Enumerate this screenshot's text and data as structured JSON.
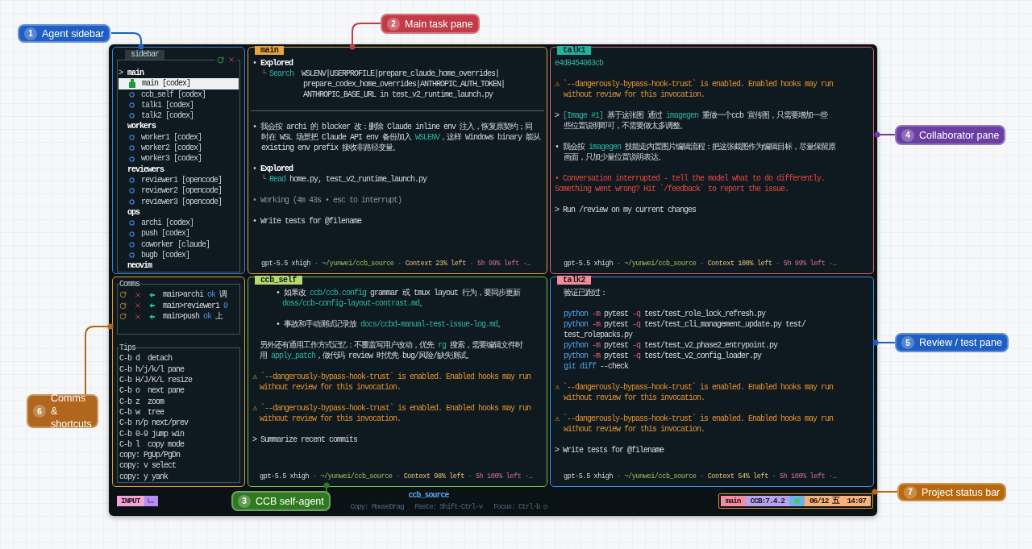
{
  "callouts": [
    {
      "number": "1",
      "label": "Agent sidebar",
      "color": "#1f5fc4"
    },
    {
      "number": "2",
      "label": "Main task pane",
      "color": "#c23b47"
    },
    {
      "number": "3",
      "label": "CCB self-agent",
      "color": "#2f7a20"
    },
    {
      "number": "4",
      "label": "Collaborator pane",
      "color": "#6a3ea3"
    },
    {
      "number": "5",
      "label": "Review / test pane",
      "color": "#1f5fc4"
    },
    {
      "number": "6",
      "label": "Comms & shortcuts",
      "color": "#b0661c"
    },
    {
      "number": "7",
      "label": "Project status bar",
      "color": "#b8690f"
    }
  ],
  "sidebar": {
    "title": "sidebar",
    "groups": [
      {
        "label": "main",
        "marker": ">",
        "agents": [
          {
            "label": "main [codex]",
            "selected": true
          },
          {
            "label": "ccb_self [codex]",
            "selected": false
          },
          {
            "label": "talk1 [codex]",
            "selected": false
          },
          {
            "label": "talk2 [codex]",
            "selected": false
          }
        ]
      },
      {
        "label": "workers",
        "agents": [
          {
            "label": "worker1 [codex]",
            "selected": false
          },
          {
            "label": "worker2 [codex]",
            "selected": false
          },
          {
            "label": "worker3 [codex]",
            "selected": false
          }
        ]
      },
      {
        "label": "reviewers",
        "agents": [
          {
            "label": "reviewer1 [opencode]",
            "selected": false
          },
          {
            "label": "reviewer2 [opencode]",
            "selected": false
          },
          {
            "label": "reviewer3 [opencode]",
            "selected": false
          }
        ]
      },
      {
        "label": "ops",
        "agents": [
          {
            "label": "archi [codex]",
            "selected": false
          },
          {
            "label": "push [codex]",
            "selected": false
          },
          {
            "label": "coworker [claude]",
            "selected": false
          },
          {
            "label": "bugb [codex]",
            "selected": false
          }
        ]
      },
      {
        "label": "neovim"
      }
    ]
  },
  "comms": {
    "title": "Comms",
    "rows": [
      {
        "route": "main>archi",
        "status": "ok",
        "note": "调"
      },
      {
        "route": "main>reviewer1",
        "status": "0"
      },
      {
        "route": "main>push",
        "status": "ok",
        "note": "上"
      }
    ]
  },
  "tips": {
    "title": "Tips",
    "lines": [
      "C-b d  detach",
      "C-b h/j/k/l pane",
      "C-b H/J/K/L resize",
      "C-b o  next pane",
      "C-b z  zoom",
      "C-b w  tree",
      "C-b n/p next/prev",
      "C-b 0-9 jump win",
      "C-b l  copy mode",
      "copy: PgUp/PgDn",
      "copy: v select",
      "copy: y yank"
    ]
  },
  "panes": [
    {
      "tab": {
        "title": "main",
        "color": "#e9a43c"
      },
      "color": "#e0a040",
      "blocks": [
        {
          "kind": "lines",
          "lines": [
            {
              "segs": [
                {
                  "kind": "plain",
                  "text": "• "
                },
                {
                  "kind": "bold",
                  "text": "Explored"
                }
              ]
            },
            {
              "kind": "hang",
              "segs": [
                {
                  "kind": "dim",
                  "text": "└ "
                },
                {
                  "kind": "accent",
                  "text": "Search"
                },
                {
                  "kind": "plain",
                  "text": "  WSLENV|USERPROFILE|prepare_claude_home_overrides|"
                }
              ]
            },
            {
              "kind": "search",
              "segs": [
                {
                  "kind": "plain",
                  "text": "prepare_codex_home_overrides|ANTHROPIC_AUTH_TOKEN|"
                }
              ]
            },
            {
              "kind": "search",
              "segs": [
                {
                  "kind": "plain",
                  "text": "ANTHROPIC_BASE_URL in test_v2_runtime_launch.py"
                }
              ]
            }
          ]
        },
        {
          "kind": "rule"
        },
        {
          "kind": "lines",
          "lines": [
            {
              "segs": [
                {
                  "kind": "plain",
                  "text": "• 我会按 archi 的 blocker 改：删除 Claude inline env 注入，恢复原契约；同"
                }
              ]
            },
            {
              "kind": "hang",
              "segs": [
                {
                  "kind": "plain",
                  "text": "时在 WSL 场景把 Claude API env 备份加入 "
                },
                {
                  "kind": "accent",
                  "text": "WSLENV"
                },
                {
                  "kind": "plain",
                  "text": "，这样 Windows binary 能从"
                }
              ]
            },
            {
              "kind": "hang",
              "segs": [
                {
                  "kind": "plain",
                  "text": "existing env prefix 接收非路径变量。"
                }
              ]
            }
          ]
        },
        {
          "kind": "lines",
          "lines": [
            {
              "segs": [
                {
                  "kind": "plain",
                  "text": "• "
                },
                {
                  "kind": "bold",
                  "text": "Explored"
                }
              ]
            },
            {
              "kind": "hang",
              "segs": [
                {
                  "kind": "dim",
                  "text": "└ "
                },
                {
                  "kind": "accent",
                  "text": "Read"
                },
                {
                  "kind": "plain",
                  "text": " home.py, test_v2_runtime_launch.py"
                }
              ]
            }
          ]
        },
        {
          "kind": "lines",
          "lines": [
            {
              "segs": [
                {
                  "kind": "dim",
                  "text": "• Working (4m 43s • esc to interrupt)"
                }
              ]
            }
          ]
        },
        {
          "kind": "lines",
          "lines": [
            {
              "segs": [
                {
                  "kind": "plain",
                  "text": "• Write tests for @filename"
                }
              ]
            }
          ]
        }
      ],
      "footer": {
        "kind": "hang",
        "segs": [
          {
            "kind": "plain",
            "text": "gpt-5.5 xhigh"
          },
          {
            "kind": "dim",
            "text": " · "
          },
          {
            "kind": "path",
            "text": "~/yunwei/ccb_source"
          },
          {
            "kind": "dim",
            "text": " · "
          },
          {
            "kind": "context",
            "text": "Context 23% left"
          },
          {
            "kind": "dim",
            "text": " · "
          },
          {
            "kind": "quota",
            "text": "5h 99% left"
          },
          {
            "kind": "dim",
            "text": " ·…"
          }
        ]
      }
    },
    {
      "tab": {
        "title": "talk1",
        "color": "#1fb3a2"
      },
      "color": "#d9607c",
      "blocks": [
        {
          "kind": "lines",
          "lines": [
            {
              "segs": [
                {
                  "kind": "hash",
                  "text": "e4d8454063cb"
                }
              ]
            }
          ]
        },
        {
          "kind": "lines",
          "lines": [
            {
              "segs": [
                {
                  "kind": "warn",
                  "text": "⚠ `--dangerously-bypass-hook-trust` is enabled. Enabled hooks may run"
                }
              ]
            },
            {
              "kind": "hang",
              "segs": [
                {
                  "kind": "warn",
                  "text": "without review for this invocation."
                }
              ]
            }
          ]
        },
        {
          "kind": "lines",
          "lines": [
            {
              "segs": [
                {
                  "kind": "plain",
                  "text": "> "
                },
                {
                  "kind": "accent",
                  "text": "[Image #1]"
                },
                {
                  "kind": "plain",
                  "text": " 基于这张图 通过 "
                },
                {
                  "kind": "accent",
                  "text": "imagegen"
                },
                {
                  "kind": "plain",
                  "text": " 重做一个ccb 宣传图，只需要增加一些"
                }
              ]
            },
            {
              "kind": "hang",
              "segs": [
                {
                  "kind": "plain",
                  "text": "些位置说明即可，不需要做太多调整。"
                }
              ]
            }
          ]
        },
        {
          "kind": "lines",
          "lines": [
            {
              "segs": [
                {
                  "kind": "plain",
                  "text": "• 我会按 "
                },
                {
                  "kind": "accent",
                  "text": "imagegen"
                },
                {
                  "kind": "plain",
                  "text": " 技能走内置图片编辑流程：把这张截图作为编辑目标，尽量保留原"
                }
              ]
            },
            {
              "kind": "hang",
              "segs": [
                {
                  "kind": "plain",
                  "text": "画面，只加少量位置说明表达。"
                }
              ]
            }
          ]
        },
        {
          "kind": "lines",
          "lines": [
            {
              "segs": [
                {
                  "kind": "error",
                  "text": "• Conversation interrupted - tell the model what to do differently."
                }
              ]
            },
            {
              "segs": [
                {
                  "kind": "error",
                  "text": "Something went wrong? Hit `/feedback` to report the issue."
                }
              ]
            }
          ]
        },
        {
          "kind": "lines",
          "lines": [
            {
              "segs": [
                {
                  "kind": "plain",
                  "text": "> Run /review on my current changes"
                }
              ]
            }
          ]
        }
      ],
      "footer": {
        "kind": "hang",
        "segs": [
          {
            "kind": "plain",
            "text": "gpt-5.5 xhigh"
          },
          {
            "kind": "dim",
            "text": " · "
          },
          {
            "kind": "path",
            "text": "~/yunwei/ccb_source"
          },
          {
            "kind": "dim",
            "text": " · "
          },
          {
            "kind": "context",
            "text": "Context 100% left"
          },
          {
            "kind": "dim",
            "text": " · "
          },
          {
            "kind": "quota",
            "text": "5h 99% left"
          },
          {
            "kind": "dim",
            "text": " ·…"
          }
        ]
      }
    },
    {
      "tab": {
        "title": "ccb_self",
        "color": "#b6d96c"
      },
      "color": "#78bd48",
      "blocks": [
        {
          "kind": "lines",
          "lines": [
            {
              "kind": "nested",
              "segs": [
                {
                  "kind": "plain",
                  "text": "• 如果改 "
                },
                {
                  "kind": "accent",
                  "text": "ccb/ccb.config"
                },
                {
                  "kind": "plain",
                  "text": " grammar 或 tmux layout 行为，要同步更新"
                }
              ]
            },
            {
              "kind": "nested_hang",
              "segs": [
                {
                  "kind": "accent",
                  "text": "doss/ccb-config-layout-contrast.md"
                },
                {
                  "kind": "plain",
                  "text": "。"
                }
              ]
            }
          ]
        },
        {
          "kind": "lines",
          "lines": [
            {
              "kind": "nested",
              "segs": [
                {
                  "kind": "plain",
                  "text": "• 事故和手动测试记录放 "
                },
                {
                  "kind": "accent",
                  "text": "docs/ccbd-manual-test-issue-log.md"
                },
                {
                  "kind": "plain",
                  "text": "。"
                }
              ]
            }
          ]
        },
        {
          "kind": "lines",
          "lines": [
            {
              "kind": "para",
              "segs": [
                {
                  "kind": "plain",
                  "text": "另外还有通用工作方式记忆：不覆盖写用户改动，优先 "
                },
                {
                  "kind": "accent",
                  "text": "rg"
                },
                {
                  "kind": "plain",
                  "text": " 搜索，需要编辑文件时"
                }
              ]
            },
            {
              "kind": "para",
              "segs": [
                {
                  "kind": "plain",
                  "text": "用 "
                },
                {
                  "kind": "accent",
                  "text": "apply_patch"
                },
                {
                  "kind": "plain",
                  "text": "，做代码 review 时优先 bug/风险/缺失测试。"
                }
              ]
            }
          ]
        },
        {
          "kind": "lines",
          "lines": [
            {
              "segs": [
                {
                  "kind": "warn",
                  "text": "⚠ `--dangerously-bypass-hook-trust` is enabled. Enabled hooks may run"
                }
              ]
            },
            {
              "kind": "para",
              "segs": [
                {
                  "kind": "warn",
                  "text": "without review for this invocation."
                }
              ]
            }
          ]
        },
        {
          "kind": "lines",
          "lines": [
            {
              "segs": [
                {
                  "kind": "warn",
                  "text": "⚠ `--dangerously-bypass-hook-trust` is enabled. Enabled hooks may run"
                }
              ]
            },
            {
              "kind": "para",
              "segs": [
                {
                  "kind": "warn",
                  "text": "without review for this invocation."
                }
              ]
            }
          ]
        },
        {
          "kind": "lines",
          "lines": [
            {
              "segs": [
                {
                  "kind": "plain",
                  "text": "> Summarize recent commits"
                }
              ]
            }
          ]
        }
      ],
      "footer": {
        "kind": "para",
        "segs": [
          {
            "kind": "plain",
            "text": "gpt-5.5 xhigh"
          },
          {
            "kind": "dim",
            "text": " · "
          },
          {
            "kind": "path",
            "text": "~/yunwei/ccb_source"
          },
          {
            "kind": "dim",
            "text": " · "
          },
          {
            "kind": "context",
            "text": "Context 98% left"
          },
          {
            "kind": "dim",
            "text": " · "
          },
          {
            "kind": "quota",
            "text": "5h 100% left"
          },
          {
            "kind": "dim",
            "text": " ·…"
          }
        ]
      }
    },
    {
      "tab": {
        "title": "talk2",
        "color": "#f28c9c"
      },
      "color": "#3b8ee0",
      "blocks": [
        {
          "kind": "lines",
          "lines": [
            {
              "kind": "hang",
              "segs": [
                {
                  "kind": "plain",
                  "text": "验证已跑过："
                }
              ]
            }
          ]
        },
        {
          "kind": "lines",
          "lines": [
            {
              "kind": "hang",
              "segs": [
                {
                  "kind": "keyword",
                  "text": "python"
                },
                {
                  "kind": "flag",
                  "text": " -m"
                },
                {
                  "kind": "plain",
                  "text": " pytest"
                },
                {
                  "kind": "flag",
                  "text": " -q"
                },
                {
                  "kind": "plain",
                  "text": " test/test_role_lock_refresh.py"
                }
              ]
            },
            {
              "kind": "hang",
              "segs": [
                {
                  "kind": "keyword",
                  "text": "python"
                },
                {
                  "kind": "flag",
                  "text": " -m"
                },
                {
                  "kind": "plain",
                  "text": " pytest"
                },
                {
                  "kind": "flag",
                  "text": " -q"
                },
                {
                  "kind": "plain",
                  "text": " test/test_cli_management_update.py test/"
                }
              ]
            },
            {
              "kind": "hang",
              "segs": [
                {
                  "kind": "plain",
                  "text": "test_rolepacks.py"
                }
              ]
            },
            {
              "kind": "hang",
              "segs": [
                {
                  "kind": "keyword",
                  "text": "python"
                },
                {
                  "kind": "flag",
                  "text": " -m"
                },
                {
                  "kind": "plain",
                  "text": " pytest"
                },
                {
                  "kind": "flag",
                  "text": " -q"
                },
                {
                  "kind": "plain",
                  "text": " test/test_v2_phase2_entrypoint.py"
                }
              ]
            },
            {
              "kind": "hang",
              "segs": [
                {
                  "kind": "keyword",
                  "text": "python"
                },
                {
                  "kind": "flag",
                  "text": " -m"
                },
                {
                  "kind": "plain",
                  "text": " pytest"
                },
                {
                  "kind": "flag",
                  "text": " -q"
                },
                {
                  "kind": "plain",
                  "text": " test/test_v2_config_loader.py"
                }
              ]
            },
            {
              "kind": "hang",
              "segs": [
                {
                  "kind": "keyword",
                  "text": "git diff"
                },
                {
                  "kind": "plain",
                  "text": " --check"
                }
              ]
            }
          ]
        },
        {
          "kind": "lines",
          "lines": [
            {
              "segs": [
                {
                  "kind": "warn",
                  "text": "⚠ `--dangerously-bypass-hook-trust` is enabled. Enabled hooks may run"
                }
              ]
            },
            {
              "kind": "hang",
              "segs": [
                {
                  "kind": "warn",
                  "text": "without review for this invocation."
                }
              ]
            }
          ]
        },
        {
          "kind": "lines",
          "lines": [
            {
              "segs": [
                {
                  "kind": "warn",
                  "text": "⚠ `--dangerously-bypass-hook-trust` is enabled. Enabled hooks may run"
                }
              ]
            },
            {
              "kind": "hang",
              "segs": [
                {
                  "kind": "warn",
                  "text": "without review for this invocation."
                }
              ]
            }
          ]
        },
        {
          "kind": "lines",
          "lines": [
            {
              "segs": [
                {
                  "kind": "plain",
                  "text": "> Write tests for @filename"
                }
              ]
            }
          ]
        }
      ],
      "footer": {
        "kind": "hang",
        "segs": [
          {
            "kind": "plain",
            "text": "gpt-5.5 xhigh"
          },
          {
            "kind": "dim",
            "text": " · "
          },
          {
            "kind": "path",
            "text": "~/yunwei/ccb_source"
          },
          {
            "kind": "dim",
            "text": " · "
          },
          {
            "kind": "context",
            "text": "Context 54% left"
          },
          {
            "kind": "dim",
            "text": " · "
          },
          {
            "kind": "quota",
            "text": "5h 100% left"
          },
          {
            "kind": "dim",
            "text": " ·…"
          }
        ]
      }
    }
  ],
  "status_bar": {
    "mode": "INPUT",
    "title": "ccb_source",
    "hints": [
      "Copy: MouseDrag",
      "Paste: Shift-Ctrl-v",
      "Focus: Ctrl-b o"
    ],
    "segments": [
      {
        "kind": "text",
        "text": "main",
        "color": "#f28ca0"
      },
      {
        "kind": "text",
        "text": "CCB:7.4.2",
        "color": "#b9a2f0"
      },
      {
        "kind": "indicator",
        "color": "#6cb2e8"
      },
      {
        "kind": "text",
        "text": "06/12 五  14:07",
        "color": "#f5b27c"
      }
    ]
  }
}
